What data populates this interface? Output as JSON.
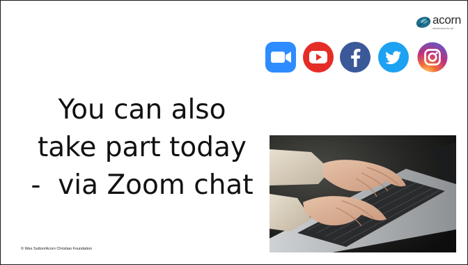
{
  "slide": {
    "heading_lines": [
      "You can also",
      "take part today",
      "-  via Zoom chat"
    ],
    "footer": "© Wes Sutton/Acorn Christian Foundation"
  },
  "logo": {
    "name": "acorn",
    "tagline": "wholeness for all"
  },
  "social_icons": [
    {
      "icon": "zoom-icon",
      "color": "#2D8CFF"
    },
    {
      "icon": "youtube-icon",
      "color": "#E52D27"
    },
    {
      "icon": "facebook-icon",
      "color": "#3B5998"
    },
    {
      "icon": "twitter-icon",
      "color": "#1DA1F2"
    },
    {
      "icon": "instagram-icon",
      "color": "#C13584"
    }
  ],
  "photo": {
    "subject": "hands-typing-on-laptop"
  }
}
